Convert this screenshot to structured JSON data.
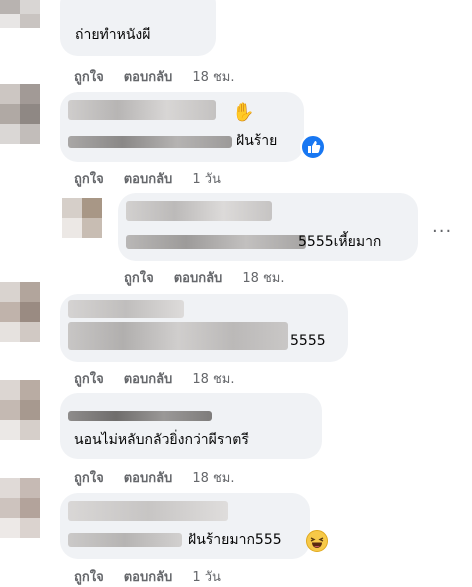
{
  "comments": [
    {
      "text": "ถ่ายทำหนังผี",
      "like": "ถูกใจ",
      "reply": "ตอบกลับ",
      "time": "18 ชม."
    },
    {
      "text": "ฝันร้าย",
      "like": "ถูกใจ",
      "reply": "ตอบกลับ",
      "time": "1 วัน",
      "reaction": "like-reaction",
      "emoji": "waving-hand-icon"
    },
    {
      "text": "5555เหี้ยมาก",
      "like": "ถูกใจ",
      "reply": "ตอบกลับ",
      "time": "18 ชม.",
      "more": "..."
    },
    {
      "text": "5555",
      "like": "ถูกใจ",
      "reply": "ตอบกลับ",
      "time": "18 ชม."
    },
    {
      "text": "นอนไม่หลับกลัวยิ่งกว่าผีราตรี",
      "like": "ถูกใจ",
      "reply": "ตอบกลับ",
      "time": "18 ชม."
    },
    {
      "text": "ฝันร้ายมาก555",
      "like": "ถูกใจ",
      "reply": "ตอบกลับ",
      "time": "1 วัน",
      "reaction": "laughing-face-emoji"
    }
  ],
  "colors": {
    "bubble": "#f0f2f5",
    "meta": "#65676b",
    "like_blue": "#1877f2"
  }
}
